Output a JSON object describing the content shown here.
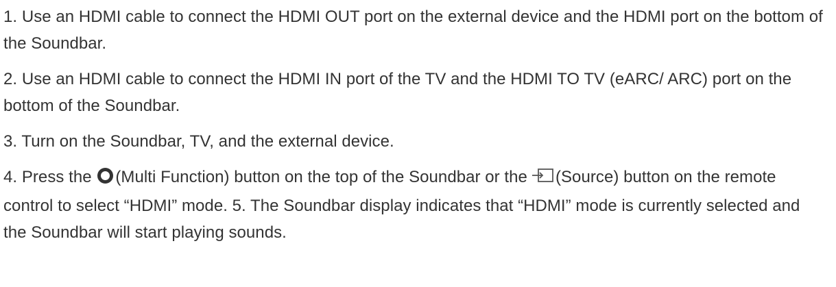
{
  "steps": [
    {
      "text": "1. Use an HDMI cable to connect the HDMI OUT port on the external device and the HDMI port on the bottom of the Soundbar."
    },
    {
      "text": "2. Use an HDMI cable to connect the HDMI IN port of the TV and the HDMI TO TV (eARC/ ARC) port on the bottom of the Soundbar."
    },
    {
      "text": "3. Turn on the Soundbar, TV, and the external device."
    },
    {
      "part1": "4. Press the ",
      "multi_function_icon": "multi-function-circle-icon",
      "part2": "(Multi Function) button on the top of the Soundbar or the",
      "source_icon": "source-input-icon",
      "part3": "(Source) button on the remote control to select “HDMI” mode. 5. The Soundbar display indicates that “HDMI” mode is currently selected and the Soundbar will start playing sounds."
    }
  ]
}
